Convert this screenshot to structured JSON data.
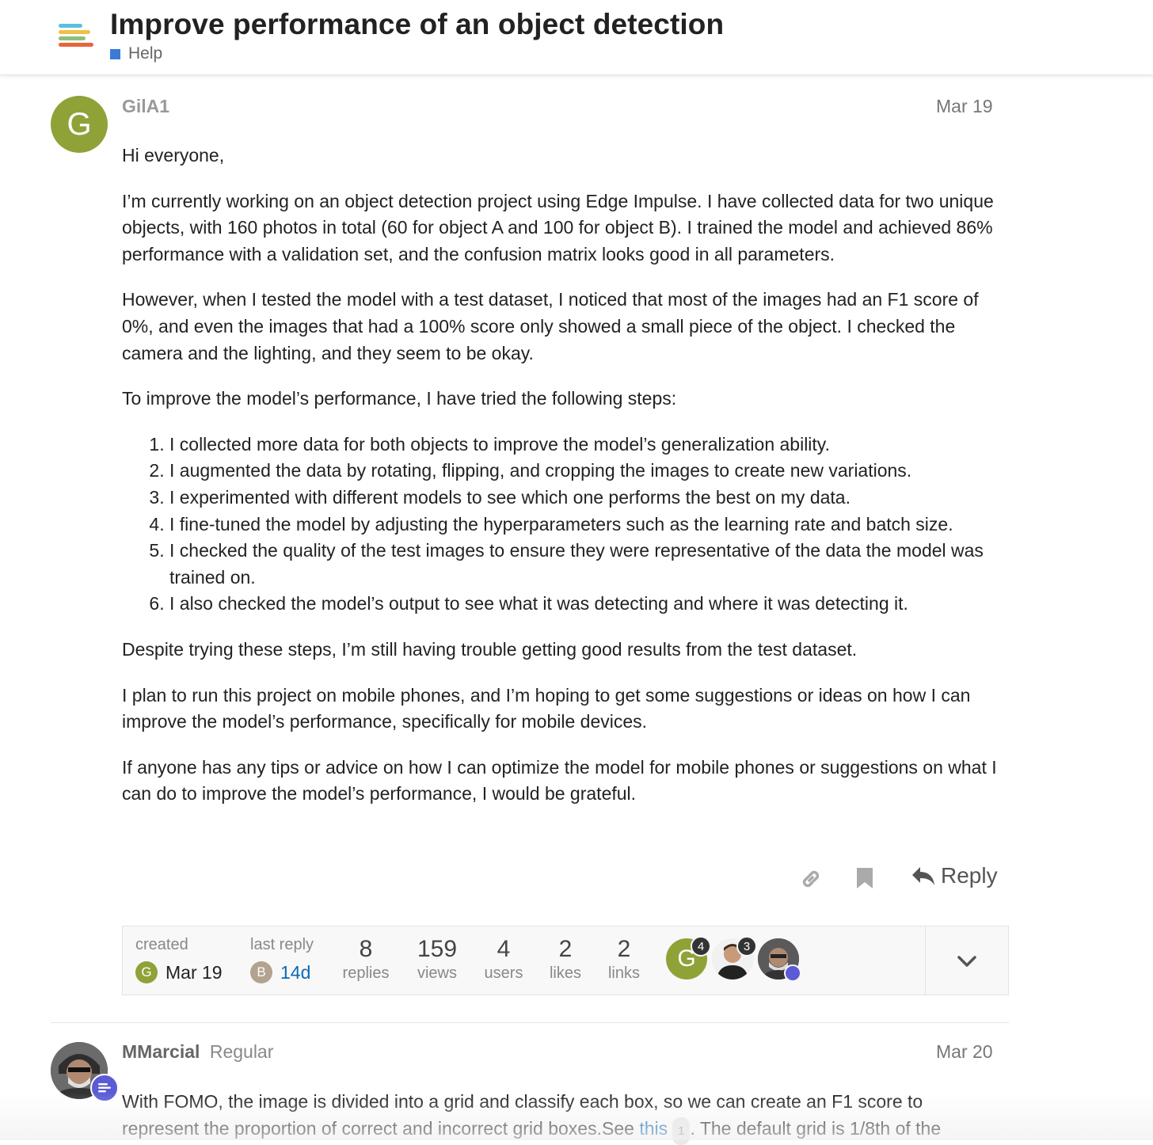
{
  "header": {
    "title": "Improve performance of an object detection",
    "category": "Help",
    "category_color": "#3a7bd5"
  },
  "post1": {
    "avatar_letter": "G",
    "username": "GilA1",
    "date": "Mar 19",
    "greeting": "Hi everyone,",
    "p1": "I’m currently working on an object detection project using Edge Impulse. I have collected data for two unique objects, with 160 photos in total (60 for object A and 100 for object B). I trained the model and achieved 86% performance with a validation set, and the confusion matrix looks good in all parameters.",
    "p2": "However, when I tested the model with a test dataset, I noticed that most of the images had an F1 score of 0%, and even the images that had a 100% score only showed a small piece of the object. I checked the camera and the lighting, and they seem to be okay.",
    "p3": "To improve the model’s performance, I have tried the following steps:",
    "steps": [
      "I collected more data for both objects to improve the model’s generalization ability.",
      "I augmented the data by rotating, flipping, and cropping the images to create new variations.",
      "I experimented with different models to see which one performs the best on my data.",
      "I fine-tuned the model by adjusting the hyperparameters such as the learning rate and batch size.",
      "I checked the quality of the test images to ensure they were representative of the data the model was trained on.",
      "I also checked the model’s output to see what it was detecting and where it was detecting it."
    ],
    "p4": "Despite trying these steps, I’m still having trouble getting good results from the test dataset.",
    "p5": "I plan to run this project on mobile phones, and I’m hoping to get some suggestions or ideas on how I can improve the model’s performance, specifically for mobile devices.",
    "p6": "If anyone has any tips or advice on how I can optimize the model for mobile phones or suggestions on what I can do to improve the model’s performance, I would be grateful.",
    "reply_label": "Reply"
  },
  "topic_map": {
    "created_label": "created",
    "created_avatar": "G",
    "created_date": "Mar 19",
    "last_reply_label": "last reply",
    "last_reply_avatar": "B",
    "last_reply_date": "14d",
    "replies_n": "8",
    "replies_label": "replies",
    "views_n": "159",
    "views_label": "views",
    "users_n": "4",
    "users_label": "users",
    "likes_n": "2",
    "likes_label": "likes",
    "links_n": "2",
    "links_label": "links",
    "participants": [
      {
        "letter": "G",
        "count": "4"
      },
      {
        "letter": "",
        "count": "3"
      },
      {
        "letter": "",
        "count": ""
      }
    ]
  },
  "post2": {
    "username": "MMarcial",
    "title": "Regular",
    "date": "Mar 20",
    "text_before": "With FOMO, the image is divided into a grid and classify each box, so we can create an F1 score to represent the proportion of correct and incorrect grid boxes.See ",
    "link": "this",
    "link_count": "1",
    "text_after": ". The default grid is 1/8th of the"
  }
}
